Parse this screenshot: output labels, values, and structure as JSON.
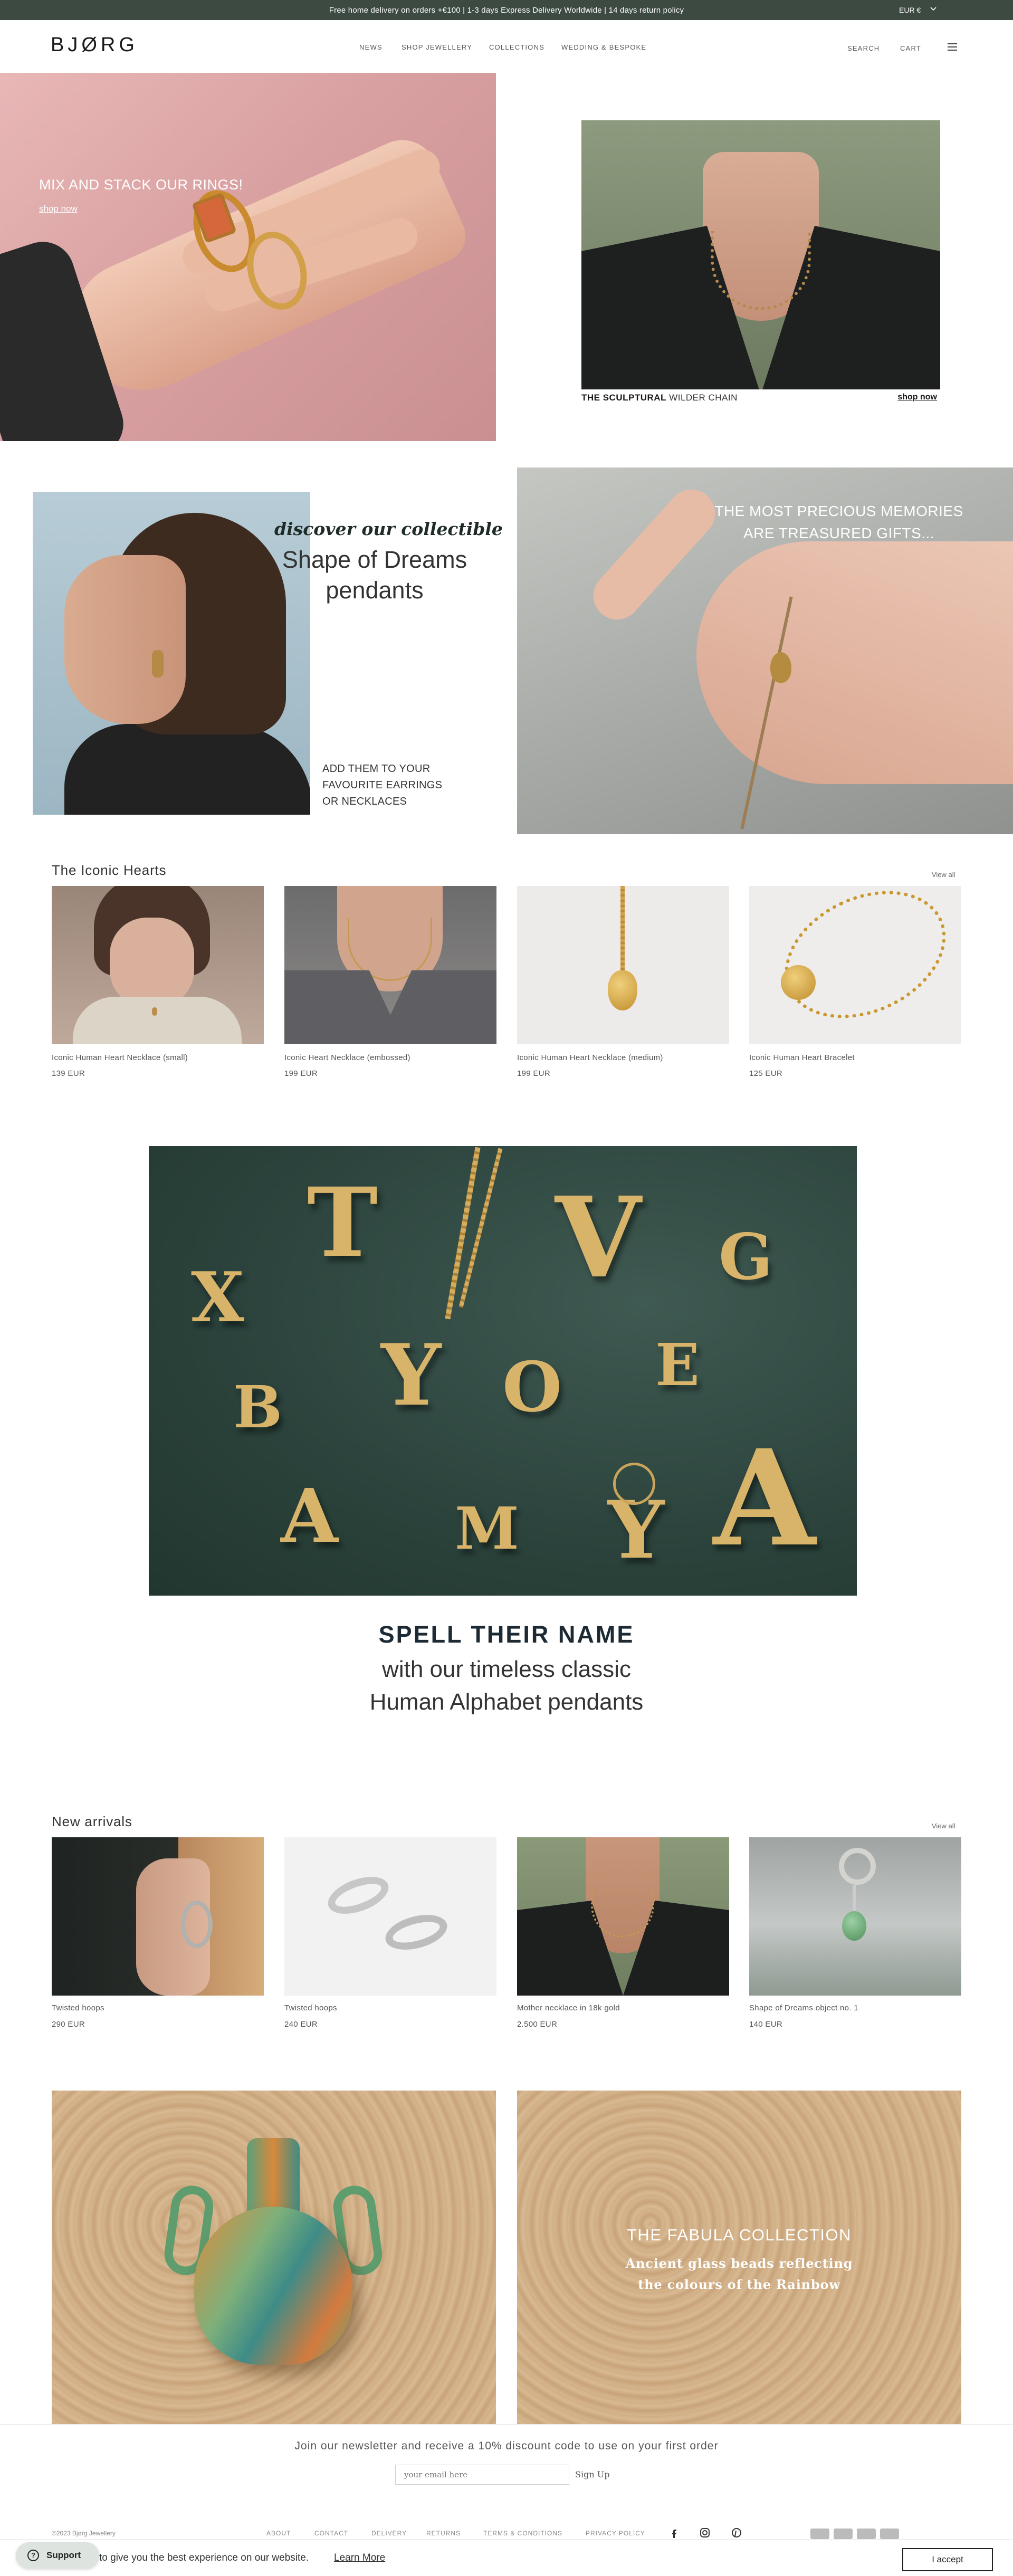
{
  "announcement": {
    "message": "Free home delivery on orders +€100 | 1-3 days Express Delivery Worldwide | 14 days return policy",
    "currency": "EUR €"
  },
  "header": {
    "logo": "BJØRG",
    "nav": [
      "NEWS",
      "SHOP JEWELLERY",
      "COLLECTIONS",
      "WEDDING & BESPOKE"
    ],
    "search": "SEARCH",
    "cart": "CART"
  },
  "hero": {
    "left_title": "MIX AND STACK OUR RINGS!",
    "left_link": "shop now",
    "right_caption_bold": "THE SCULPTURAL",
    "right_caption_rest": " WILDER CHAIN",
    "right_link": "shop now"
  },
  "feature": {
    "discover": "discover our collectible",
    "sod_line1": "Shape of Dreams",
    "sod_line2": "pendants",
    "add_line1": "ADD THEM TO YOUR",
    "add_line2": "FAVOURITE EARRINGS",
    "add_line3": "OR NECKLACES",
    "precious_line1": "THE MOST PRECIOUS MEMORIES",
    "precious_line2": "ARE TREASURED GIFTS..."
  },
  "iconic": {
    "title": "The Iconic Hearts",
    "view_all": "View all",
    "products": [
      {
        "name": "Iconic Human Heart Necklace (small)",
        "price": "139 EUR"
      },
      {
        "name": "Iconic Heart Necklace (embossed)",
        "price": "199 EUR"
      },
      {
        "name": "Iconic Human Heart Necklace (medium)",
        "price": "199 EUR"
      },
      {
        "name": "Iconic Human Heart Bracelet",
        "price": "125 EUR"
      }
    ]
  },
  "alphabet": {
    "heading": "SPELL THEIR NAME",
    "line1": "with our timeless classic",
    "line2": "Human Alphabet pendants"
  },
  "new_arrivals": {
    "title": "New arrivals",
    "view_all": "View all",
    "products": [
      {
        "name": "Twisted hoops",
        "price": "290 EUR"
      },
      {
        "name": "Twisted hoops",
        "price": "240 EUR"
      },
      {
        "name": "Mother necklace in 18k gold",
        "price": "2.500 EUR"
      },
      {
        "name": "Shape of Dreams object no. 1",
        "price": "140 EUR"
      }
    ]
  },
  "fabula": {
    "title": "THE FABULA COLLECTION",
    "sub1": "Ancient glass beads reflecting",
    "sub2": "the colours of the Rainbow"
  },
  "newsletter": {
    "text": "Join our newsletter and receive a 10% discount code to use on your first order",
    "placeholder": "your email here",
    "button": "Sign Up"
  },
  "footer": {
    "copyright": "©2023 Bjørg Jewellery",
    "links": [
      "ABOUT",
      "CONTACT",
      "DELIVERY",
      "RETURNS",
      "TERMS & CONDITIONS",
      "PRIVACY POLICY"
    ]
  },
  "cookie": {
    "text": "to give you the best experience on our website.",
    "learn_more": "Learn More",
    "accept": "I accept",
    "support": "Support"
  },
  "colors": {
    "topbar": "#3c4a42",
    "accent_dark": "#1e2b26",
    "gold": "#d8b36a"
  }
}
